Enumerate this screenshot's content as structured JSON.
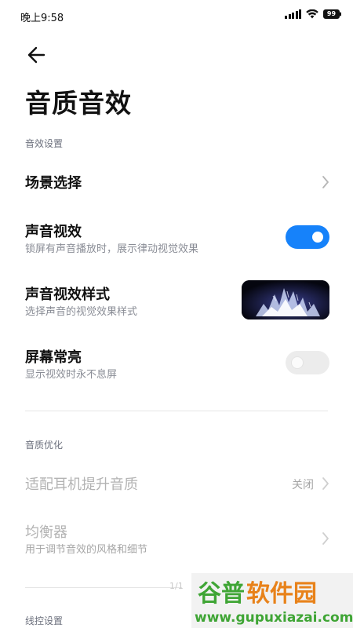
{
  "status_bar": {
    "time": "晚上9:58",
    "battery": "99",
    "signal_icon": "signal-bars-icon",
    "wifi_icon": "wifi-icon"
  },
  "header": {
    "back_icon": "back-arrow-icon",
    "title": "音质音效"
  },
  "sections": {
    "effects": {
      "header": "音效设置",
      "scene": {
        "title": "场景选择"
      },
      "sound_visual": {
        "title": "声音视效",
        "subtitle": "锁屏有声音播放时，展示律动视觉效果",
        "enabled": true
      },
      "visual_style": {
        "title": "声音视效样式",
        "subtitle": "选择声音的视觉效果样式"
      },
      "screen_on": {
        "title": "屏幕常亮",
        "subtitle": "显示视效时永不息屏",
        "enabled": false
      }
    },
    "quality": {
      "header": "音质优化",
      "headphone": {
        "title": "适配耳机提升音质",
        "value": "关闭"
      },
      "equalizer": {
        "title": "均衡器",
        "subtitle": "用于调节音效的风格和细节"
      }
    },
    "wire_control": {
      "header": "线控设置"
    }
  },
  "page_indicator": "1/1",
  "watermark": {
    "brand": "谷普软件园",
    "url": "www.gupuxiazai.com"
  },
  "colors": {
    "accent": "#1682fa",
    "section_header": "#6b6f7c",
    "subtitle": "#8a8d96",
    "disabled": "#b3b3b3"
  }
}
